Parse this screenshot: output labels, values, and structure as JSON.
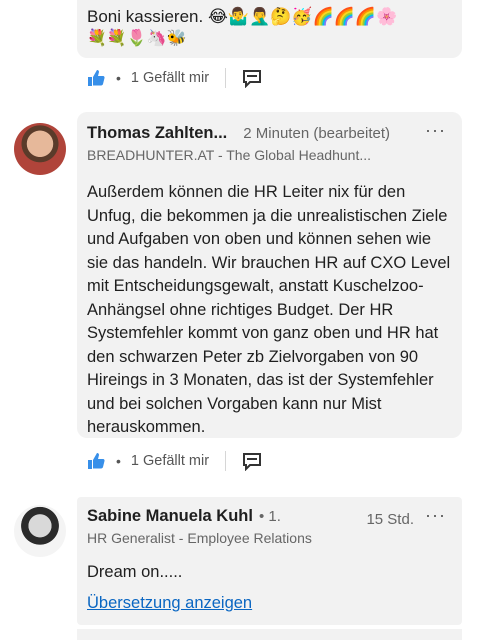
{
  "prev_comment": {
    "text": "Boni kassieren.",
    "emoji_line1": "😂🤷‍♂️🤦‍♂️🤔🥳🌈🌈🌈🌸",
    "emoji_line2": "💐💐🌷🦄🐝"
  },
  "actions": [
    {
      "likes_label": "1 Gefällt mir"
    },
    {
      "likes_label": "1 Gefällt mir"
    }
  ],
  "comments": [
    {
      "author": "Thomas Zahlten...",
      "time": "2 Minuten (bearbeitet)",
      "headline": "BREADHUNTER.AT - The Global Headhunt...",
      "text": "Außerdem können die HR Leiter nix für den Unfug, die bekommen ja die unrealistischen Ziele und Aufgaben von oben und können sehen wie sie das handeln. Wir brauchen HR auf CXO Level mit Entscheidungsgewalt, anstatt Kuschelzoo-Anhängsel ohne richtiges Budget. Der HR Systemfehler kommt von ganz oben und HR hat den schwarzen Peter zb Zielvorgaben von 90 Hireings in 3 Monaten, das ist der Systemfehler und bei solchen Vorgaben kann nur Mist herauskommen.",
      "more": "···"
    },
    {
      "author": "Sabine Manuela Kuhl",
      "degree": "• 1.",
      "time": "15 Std.",
      "headline": "HR Generalist - Employee Relations",
      "text": "Dream on.....",
      "translate_link": "Übersetzung anzeigen",
      "more": "···"
    }
  ],
  "colors": {
    "accent": "#0a66c2",
    "bubble": "#f2f2f2",
    "like_icon": "#378fe9"
  }
}
